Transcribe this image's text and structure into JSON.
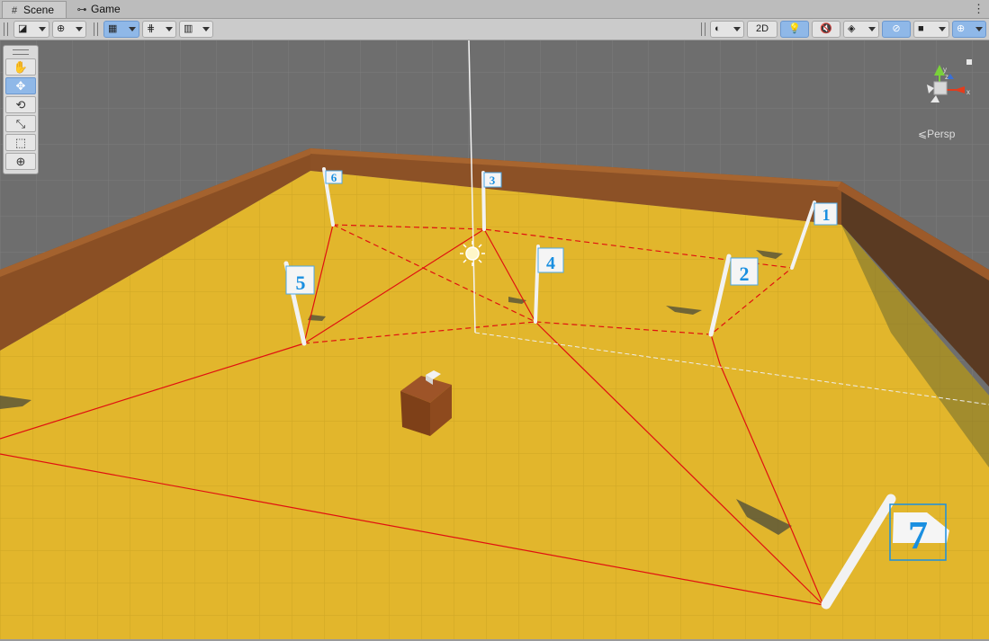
{
  "tabs": [
    {
      "label": "Scene",
      "icon": "grid-icon",
      "active": true
    },
    {
      "label": "Game",
      "icon": "gamepad-icon",
      "active": false
    }
  ],
  "toolbar": {
    "twod_label": "2D",
    "accent": "#8fb8e8"
  },
  "tools": [
    {
      "name": "hand-tool-button",
      "icon": "hand-icon",
      "glyph": "✋",
      "active": false
    },
    {
      "name": "move-tool-button",
      "icon": "move-icon",
      "glyph": "✥",
      "active": true
    },
    {
      "name": "rotate-tool-button",
      "icon": "rotate-icon",
      "glyph": "⟲",
      "active": false
    },
    {
      "name": "scale-tool-button",
      "icon": "scale-icon",
      "glyph": "⤡",
      "active": false
    },
    {
      "name": "rect-tool-button",
      "icon": "rect-transform-icon",
      "glyph": "⬚",
      "active": false
    },
    {
      "name": "transform-tool-button",
      "icon": "transform-icon",
      "glyph": "⊕",
      "active": false
    }
  ],
  "scene": {
    "projection_label": "Persp",
    "gizmo_axes": {
      "y": "y",
      "z": "z",
      "x": "x"
    },
    "flags": [
      {
        "number": "1"
      },
      {
        "number": "2"
      },
      {
        "number": "3"
      },
      {
        "number": "4"
      },
      {
        "number": "5"
      },
      {
        "number": "6"
      },
      {
        "number": "7"
      }
    ],
    "colors": {
      "floor": "#e2b62c",
      "wall": "#8a4f24",
      "background": "#6e6e6e",
      "path": "#e01010",
      "selection": "#1a8fe0"
    }
  }
}
